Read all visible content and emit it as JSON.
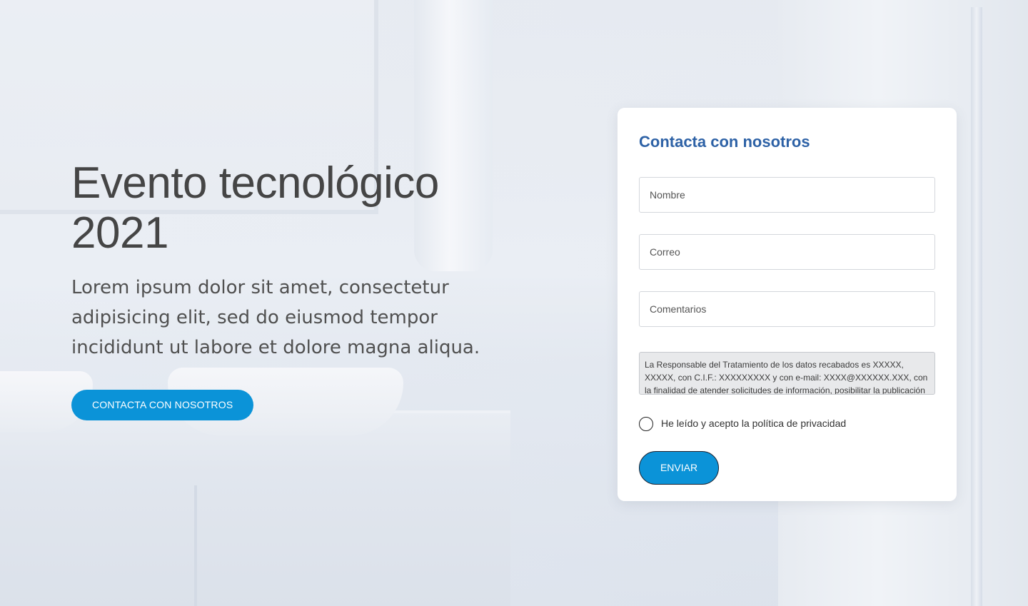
{
  "hero": {
    "title_line1": "Evento tecnológico",
    "title_line2": "2021",
    "description": "Lorem ipsum dolor sit amet, consectetur adipisicing elit, sed do eiusmod tempor incididunt ut labore et dolore magna aliqua.",
    "cta_label": "CONTACTA CON NOSOTROS"
  },
  "contact_form": {
    "title": "Contacta con nosotros",
    "name_placeholder": "Nombre",
    "email_placeholder": "Correo",
    "comments_placeholder": "Comentarios",
    "legal_text": "La Responsable del Tratamiento de los datos recabados es XXXXX, XXXXX, con C.I.F.: XXXXXXXXX y con e-mail: XXXX@XXXXXX.XXX, con la finalidad de atender solicitudes de información, posibilitar la publicación",
    "privacy_label": "He leído y acepto la política de privacidad",
    "submit_label": "ENVIAR"
  },
  "colors": {
    "accent": "#0b93d8",
    "form_title": "#2e62a6",
    "heading_text": "#454545"
  }
}
